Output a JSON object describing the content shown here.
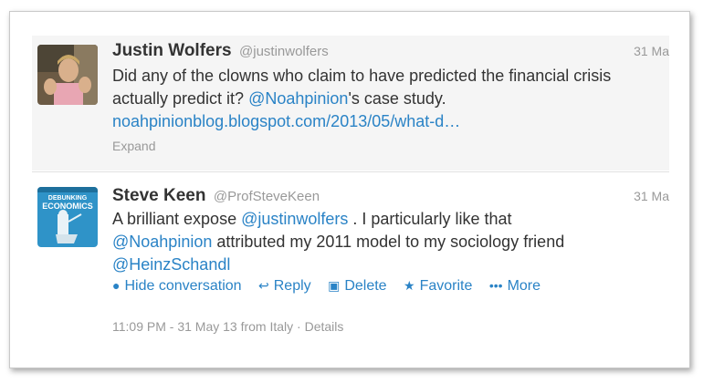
{
  "tweets": [
    {
      "name": "Justin Wolfers",
      "handle": "@justinwolfers",
      "date": "31 Ma",
      "line1": "Did any of the clowns who claim to have predicted the financial crisis",
      "line2_mention": "@Noahpinion",
      "line2_rest": "'s case study.",
      "line2_pre": "actually predict it? ",
      "url": "noahpinionblog.blogspot.com/2013/05/what-d…",
      "expand": "Expand"
    },
    {
      "name": "Steve Keen",
      "handle": "@ProfSteveKeen",
      "date": "31 Ma",
      "line1_pre": "A brilliant expose ",
      "line1_mention": "@justinwolfers",
      "line1_rest": " . I particularly like that",
      "line2_mention": "@Noahpinion",
      "line2_rest": " attributed my 2011 model to my sociology friend",
      "line3_mention": "@HeinzSchandl",
      "avatar_text": "DEBUNKING ECONOMICS"
    }
  ],
  "actions": {
    "hide": "Hide conversation",
    "reply": "Reply",
    "delete": "Delete",
    "favorite": "Favorite",
    "more": "More"
  },
  "meta": {
    "time": "11:09 PM - 31 May 13 from Italy",
    "sep": " · ",
    "details": "Details"
  },
  "colors": {
    "link": "#2a83c6",
    "muted": "#999999",
    "text": "#333333"
  },
  "icons": {
    "hide": "speech-bubble-icon",
    "reply": "reply-arrow-icon",
    "delete": "trash-icon",
    "favorite": "star-icon",
    "more": "dots-icon"
  }
}
